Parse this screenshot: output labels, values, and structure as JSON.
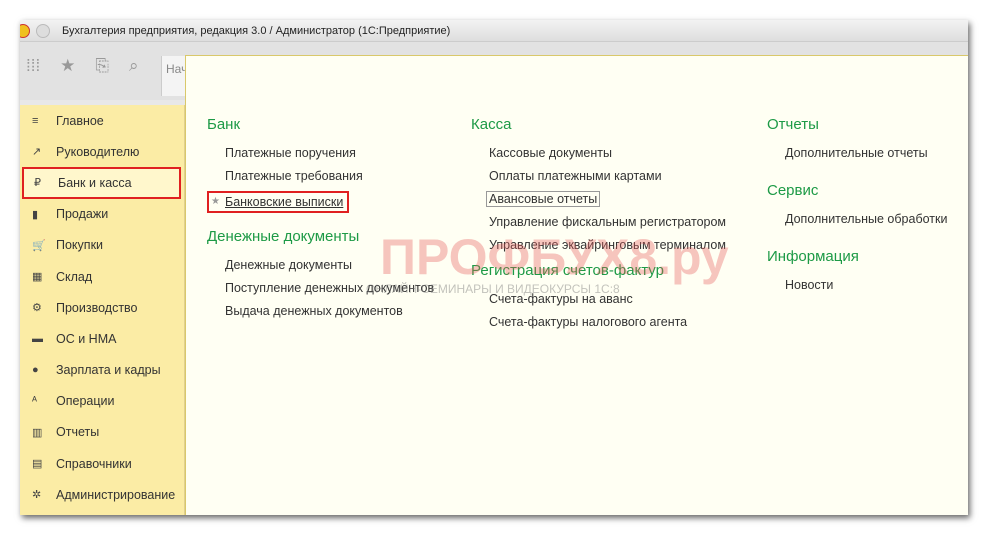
{
  "window": {
    "title": "Бухгалтерия предприятия, редакция 3.0 / Администратор  (1С:Предприятие)",
    "tab_stub": "Нач"
  },
  "sidebar": [
    {
      "label": "Главное",
      "icon": "≡"
    },
    {
      "label": "Руководителю",
      "icon": "↗"
    },
    {
      "label": "Банк и касса",
      "icon": "₽"
    },
    {
      "label": "Продажи",
      "icon": "▮"
    },
    {
      "label": "Покупки",
      "icon": "🛒"
    },
    {
      "label": "Склад",
      "icon": "▦"
    },
    {
      "label": "Производство",
      "icon": "⚙"
    },
    {
      "label": "ОС и НМА",
      "icon": "▬"
    },
    {
      "label": "Зарплата и кадры",
      "icon": "●"
    },
    {
      "label": "Операции",
      "icon": "ᴬ"
    },
    {
      "label": "Отчеты",
      "icon": "▥"
    },
    {
      "label": "Справочники",
      "icon": "▤"
    },
    {
      "label": "Администрирование",
      "icon": "✲"
    }
  ],
  "sections": {
    "bank": {
      "title": "Банк",
      "items": [
        "Платежные поручения",
        "Платежные требования",
        "Банковские выписки"
      ]
    },
    "money": {
      "title": "Денежные документы",
      "items": [
        "Денежные документы",
        "Поступление денежных документов",
        "Выдача денежных документов"
      ]
    },
    "kassa": {
      "title": "Касса",
      "items": [
        "Кассовые документы",
        "Оплаты платежными картами",
        "Авансовые отчеты",
        "Управление фискальным регистратором",
        "Управление эквайринговым терминалом"
      ]
    },
    "invoices": {
      "title": "Регистрация счетов-фактур",
      "items": [
        "Счета-фактуры на аванс",
        "Счета-фактуры налогового агента"
      ]
    },
    "reports": {
      "title": "Отчеты",
      "items": [
        "Дополнительные отчеты"
      ]
    },
    "service": {
      "title": "Сервис",
      "items": [
        "Дополнительные обработки"
      ]
    },
    "info": {
      "title": "Информация",
      "items": [
        "Новости"
      ]
    }
  },
  "watermark": {
    "main": "ПРОФБУХ8.ру",
    "sub": "ОНЛАЙН-СЕМИНАРЫ И ВИДЕОКУРСЫ 1С:8"
  }
}
